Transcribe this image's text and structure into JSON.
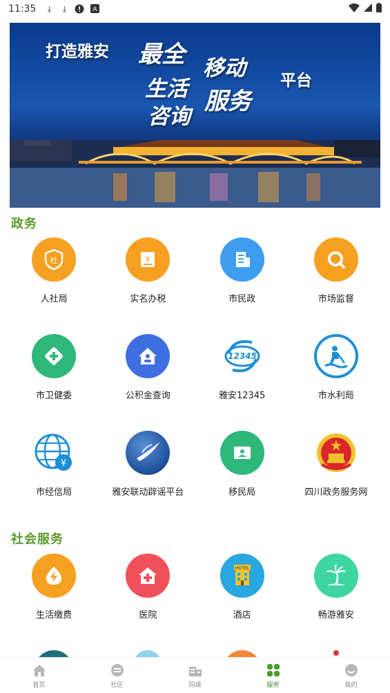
{
  "status": {
    "time": "11:35"
  },
  "banner": {
    "line1": "打造雅安",
    "line2": "最全",
    "line3": "移动",
    "line4": "生活",
    "line5": "服务",
    "line6": "咨询",
    "line7": "平台"
  },
  "sections": {
    "gov": {
      "title": "政务",
      "items": [
        {
          "label": "人社局",
          "icon": "shield-icon",
          "color": "#f6a021"
        },
        {
          "label": "实名办税",
          "icon": "tax-icon",
          "color": "#f6a021"
        },
        {
          "label": "市民政",
          "icon": "building-icon",
          "color": "#3d9ef0"
        },
        {
          "label": "市场监督",
          "icon": "search-icon",
          "color": "#f6a021"
        },
        {
          "label": "市卫健委",
          "icon": "medical-cross-icon",
          "color": "#2eb87a"
        },
        {
          "label": "公积金查询",
          "icon": "house-icon",
          "color": "#3f6ee0"
        },
        {
          "label": "雅安12345",
          "icon": "hotline-12345-icon",
          "color": "#1d8fd6"
        },
        {
          "label": "市水利局",
          "icon": "worker-icon",
          "color": "#1d8fd6"
        },
        {
          "label": "市经信局",
          "icon": "globe-yen-icon",
          "color": "#1d8fd6"
        },
        {
          "label": "雅安联动辟谣平台",
          "icon": "swoosh-logo-icon",
          "color": "#1e4f9a"
        },
        {
          "label": "移民局",
          "icon": "id-card-icon",
          "color": "#2eb87a"
        },
        {
          "label": "四川政务服务网",
          "icon": "national-emblem-icon",
          "color": "#d9262b"
        }
      ]
    },
    "social": {
      "title": "社会服务",
      "items": [
        {
          "label": "生活缴费",
          "icon": "lightning-icon",
          "color": "#f6a021"
        },
        {
          "label": "医院",
          "icon": "hospital-icon",
          "color": "#f0505a"
        },
        {
          "label": "酒店",
          "icon": "hotel-icon",
          "color": "#29a7e0"
        },
        {
          "label": "畅游雅安",
          "icon": "palm-tree-icon",
          "color": "#3dd6a0"
        }
      ]
    }
  },
  "tabbar": [
    {
      "label": "首页",
      "icon": "home-icon",
      "active": false
    },
    {
      "label": "社区",
      "icon": "chat-icon",
      "active": false
    },
    {
      "label": "同城",
      "icon": "city-icon",
      "active": false
    },
    {
      "label": "服务",
      "icon": "grid-icon",
      "active": true
    },
    {
      "label": "我的",
      "icon": "profile-icon",
      "active": false
    }
  ]
}
